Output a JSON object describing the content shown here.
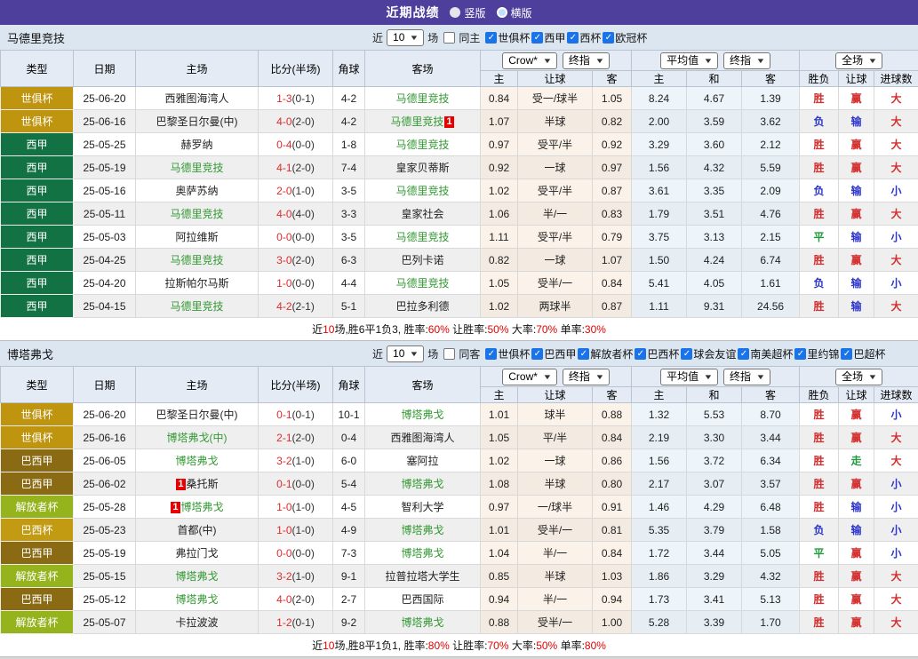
{
  "topbar": {
    "title": "近期战绩",
    "options": [
      {
        "label": "竖版",
        "checked": false
      },
      {
        "label": "横版",
        "checked": true
      }
    ]
  },
  "icons": {
    "check": "✓",
    "dropdown_arrow": "▼"
  },
  "colors": {
    "topbar_bg": "#4e3f9d",
    "checkbox_blue": "#1a73e8",
    "accent_red": "#e60000",
    "team_green": "#339933",
    "score_red": "#e12b2b",
    "leagues": {
      "世俱杯": "#bf940f",
      "西甲": "#127243",
      "巴西甲": "#8a6a12",
      "解放者杯": "#95b31d",
      "巴西杯": "#c39b13"
    },
    "result": {
      "r": "#d42f2f",
      "b": "#2d35c8",
      "g": "#22993e"
    }
  },
  "table_header": {
    "main_columns": [
      "类型",
      "日期",
      "主场",
      "比分(半场)",
      "角球",
      "客场"
    ],
    "sub_columns": [
      "主",
      "让球",
      "客",
      "主",
      "和",
      "客",
      "胜负",
      "让球",
      "进球数"
    ],
    "selects": {
      "book": "Crow*",
      "book_final": "终指",
      "avg": "平均值",
      "avg_final": "终指",
      "scope": "全场"
    }
  },
  "sections": [
    {
      "team": "马德里竞技",
      "filter": {
        "prefix": "近",
        "count": "10",
        "suffix": "场",
        "same_side_label": "同主",
        "same_side_checked": false,
        "leagues": [
          "世俱杯",
          "西甲",
          "西杯",
          "欧冠杯"
        ]
      },
      "rows": [
        {
          "lg": "世俱杯",
          "date": "25-06-20",
          "home": {
            "n": "西雅图海湾人"
          },
          "score": "1-3",
          "half": "(0-1)",
          "corner": "4-2",
          "away": {
            "n": "马德里竞技",
            "g": 1
          },
          "o": [
            "0.84",
            "受一/球半",
            "1.05"
          ],
          "a": [
            "8.24",
            "4.67",
            "1.39"
          ],
          "r": [
            [
              "胜",
              "r"
            ],
            [
              "赢",
              "r"
            ],
            [
              "大",
              "r"
            ]
          ]
        },
        {
          "lg": "世俱杯",
          "date": "25-06-16",
          "home": {
            "n": "巴黎圣日尔曼(中)"
          },
          "score": "4-0",
          "half": "(2-0)",
          "corner": "4-2",
          "away": {
            "n": "马德里竞技",
            "g": 1,
            "b": "1",
            "bp": "after"
          },
          "o": [
            "1.07",
            "半球",
            "0.82"
          ],
          "a": [
            "2.00",
            "3.59",
            "3.62"
          ],
          "r": [
            [
              "负",
              "b"
            ],
            [
              "输",
              "b"
            ],
            [
              "大",
              "r"
            ]
          ]
        },
        {
          "lg": "西甲",
          "date": "25-05-25",
          "home": {
            "n": "赫罗纳"
          },
          "score": "0-4",
          "half": "(0-0)",
          "corner": "1-8",
          "away": {
            "n": "马德里竞技",
            "g": 1
          },
          "o": [
            "0.97",
            "受平/半",
            "0.92"
          ],
          "a": [
            "3.29",
            "3.60",
            "2.12"
          ],
          "r": [
            [
              "胜",
              "r"
            ],
            [
              "赢",
              "r"
            ],
            [
              "大",
              "r"
            ]
          ]
        },
        {
          "lg": "西甲",
          "date": "25-05-19",
          "home": {
            "n": "马德里竞技",
            "g": 1
          },
          "score": "4-1",
          "half": "(2-0)",
          "corner": "7-4",
          "away": {
            "n": "皇家贝蒂斯"
          },
          "o": [
            "0.92",
            "一球",
            "0.97"
          ],
          "a": [
            "1.56",
            "4.32",
            "5.59"
          ],
          "r": [
            [
              "胜",
              "r"
            ],
            [
              "赢",
              "r"
            ],
            [
              "大",
              "r"
            ]
          ]
        },
        {
          "lg": "西甲",
          "date": "25-05-16",
          "home": {
            "n": "奥萨苏纳"
          },
          "score": "2-0",
          "half": "(1-0)",
          "corner": "3-5",
          "away": {
            "n": "马德里竞技",
            "g": 1
          },
          "o": [
            "1.02",
            "受平/半",
            "0.87"
          ],
          "a": [
            "3.61",
            "3.35",
            "2.09"
          ],
          "r": [
            [
              "负",
              "b"
            ],
            [
              "输",
              "b"
            ],
            [
              "小",
              "b"
            ]
          ]
        },
        {
          "lg": "西甲",
          "date": "25-05-11",
          "home": {
            "n": "马德里竞技",
            "g": 1
          },
          "score": "4-0",
          "half": "(4-0)",
          "corner": "3-3",
          "away": {
            "n": "皇家社会"
          },
          "o": [
            "1.06",
            "半/一",
            "0.83"
          ],
          "a": [
            "1.79",
            "3.51",
            "4.76"
          ],
          "r": [
            [
              "胜",
              "r"
            ],
            [
              "赢",
              "r"
            ],
            [
              "大",
              "r"
            ]
          ]
        },
        {
          "lg": "西甲",
          "date": "25-05-03",
          "home": {
            "n": "阿拉维斯"
          },
          "score": "0-0",
          "half": "(0-0)",
          "corner": "3-5",
          "away": {
            "n": "马德里竞技",
            "g": 1
          },
          "o": [
            "1.11",
            "受平/半",
            "0.79"
          ],
          "a": [
            "3.75",
            "3.13",
            "2.15"
          ],
          "r": [
            [
              "平",
              "g"
            ],
            [
              "输",
              "b"
            ],
            [
              "小",
              "b"
            ]
          ]
        },
        {
          "lg": "西甲",
          "date": "25-04-25",
          "home": {
            "n": "马德里竞技",
            "g": 1
          },
          "score": "3-0",
          "half": "(2-0)",
          "corner": "6-3",
          "away": {
            "n": "巴列卡诺"
          },
          "o": [
            "0.82",
            "一球",
            "1.07"
          ],
          "a": [
            "1.50",
            "4.24",
            "6.74"
          ],
          "r": [
            [
              "胜",
              "r"
            ],
            [
              "赢",
              "r"
            ],
            [
              "大",
              "r"
            ]
          ]
        },
        {
          "lg": "西甲",
          "date": "25-04-20",
          "home": {
            "n": "拉斯帕尔马斯"
          },
          "score": "1-0",
          "half": "(0-0)",
          "corner": "4-4",
          "away": {
            "n": "马德里竞技",
            "g": 1
          },
          "o": [
            "1.05",
            "受半/一",
            "0.84"
          ],
          "a": [
            "5.41",
            "4.05",
            "1.61"
          ],
          "r": [
            [
              "负",
              "b"
            ],
            [
              "输",
              "b"
            ],
            [
              "小",
              "b"
            ]
          ]
        },
        {
          "lg": "西甲",
          "date": "25-04-15",
          "home": {
            "n": "马德里竞技",
            "g": 1
          },
          "score": "4-2",
          "half": "(2-1)",
          "corner": "5-1",
          "away": {
            "n": "巴拉多利德"
          },
          "o": [
            "1.02",
            "两球半",
            "0.87"
          ],
          "a": [
            "1.11",
            "9.31",
            "24.56"
          ],
          "r": [
            [
              "胜",
              "r"
            ],
            [
              "输",
              "b"
            ],
            [
              "大",
              "r"
            ]
          ]
        }
      ],
      "summary": [
        {
          "t": "近"
        },
        {
          "t": "10",
          "red": true
        },
        {
          "t": "场,胜6平1负3, 胜率:"
        },
        {
          "t": "60%",
          "red": true
        },
        {
          "t": " 让胜率:"
        },
        {
          "t": "50%",
          "red": true
        },
        {
          "t": " 大率:"
        },
        {
          "t": "70%",
          "red": true
        },
        {
          "t": " 单率:"
        },
        {
          "t": "30%",
          "red": true
        }
      ]
    },
    {
      "team": "博塔弗戈",
      "filter": {
        "prefix": "近",
        "count": "10",
        "suffix": "场",
        "same_side_label": "同客",
        "same_side_checked": false,
        "leagues": [
          "世俱杯",
          "巴西甲",
          "解放者杯",
          "巴西杯",
          "球会友谊",
          "南美超杯",
          "里约锦",
          "巴超杯"
        ]
      },
      "rows": [
        {
          "lg": "世俱杯",
          "date": "25-06-20",
          "home": {
            "n": "巴黎圣日尔曼(中)"
          },
          "score": "0-1",
          "half": "(0-1)",
          "corner": "10-1",
          "away": {
            "n": "博塔弗戈",
            "g": 1
          },
          "o": [
            "1.01",
            "球半",
            "0.88"
          ],
          "a": [
            "1.32",
            "5.53",
            "8.70"
          ],
          "r": [
            [
              "胜",
              "r"
            ],
            [
              "赢",
              "r"
            ],
            [
              "小",
              "b"
            ]
          ]
        },
        {
          "lg": "世俱杯",
          "date": "25-06-16",
          "home": {
            "n": "博塔弗戈(中)",
            "g": 1
          },
          "score": "2-1",
          "half": "(2-0)",
          "corner": "0-4",
          "away": {
            "n": "西雅图海湾人"
          },
          "o": [
            "1.05",
            "平/半",
            "0.84"
          ],
          "a": [
            "2.19",
            "3.30",
            "3.44"
          ],
          "r": [
            [
              "胜",
              "r"
            ],
            [
              "赢",
              "r"
            ],
            [
              "大",
              "r"
            ]
          ]
        },
        {
          "lg": "巴西甲",
          "date": "25-06-05",
          "home": {
            "n": "博塔弗戈",
            "g": 1
          },
          "score": "3-2",
          "half": "(1-0)",
          "corner": "6-0",
          "away": {
            "n": "塞阿拉"
          },
          "o": [
            "1.02",
            "一球",
            "0.86"
          ],
          "a": [
            "1.56",
            "3.72",
            "6.34"
          ],
          "r": [
            [
              "胜",
              "r"
            ],
            [
              "走",
              "g"
            ],
            [
              "大",
              "r"
            ]
          ]
        },
        {
          "lg": "巴西甲",
          "date": "25-06-02",
          "home": {
            "n": "桑托斯",
            "b": "1",
            "bp": "before"
          },
          "score": "0-1",
          "half": "(0-0)",
          "corner": "5-4",
          "away": {
            "n": "博塔弗戈",
            "g": 1
          },
          "o": [
            "1.08",
            "半球",
            "0.80"
          ],
          "a": [
            "2.17",
            "3.07",
            "3.57"
          ],
          "r": [
            [
              "胜",
              "r"
            ],
            [
              "赢",
              "r"
            ],
            [
              "小",
              "b"
            ]
          ]
        },
        {
          "lg": "解放者杯",
          "date": "25-05-28",
          "home": {
            "n": "博塔弗戈",
            "g": 1,
            "b": "1",
            "bp": "before"
          },
          "score": "1-0",
          "half": "(1-0)",
          "corner": "4-5",
          "away": {
            "n": "智利大学"
          },
          "o": [
            "0.97",
            "一/球半",
            "0.91"
          ],
          "a": [
            "1.46",
            "4.29",
            "6.48"
          ],
          "r": [
            [
              "胜",
              "r"
            ],
            [
              "输",
              "b"
            ],
            [
              "小",
              "b"
            ]
          ]
        },
        {
          "lg": "巴西杯",
          "date": "25-05-23",
          "home": {
            "n": "首都(中)"
          },
          "score": "1-0",
          "half": "(1-0)",
          "corner": "4-9",
          "away": {
            "n": "博塔弗戈",
            "g": 1
          },
          "o": [
            "1.01",
            "受半/一",
            "0.81"
          ],
          "a": [
            "5.35",
            "3.79",
            "1.58"
          ],
          "r": [
            [
              "负",
              "b"
            ],
            [
              "输",
              "b"
            ],
            [
              "小",
              "b"
            ]
          ]
        },
        {
          "lg": "巴西甲",
          "date": "25-05-19",
          "home": {
            "n": "弗拉门戈"
          },
          "score": "0-0",
          "half": "(0-0)",
          "corner": "7-3",
          "away": {
            "n": "博塔弗戈",
            "g": 1
          },
          "o": [
            "1.04",
            "半/一",
            "0.84"
          ],
          "a": [
            "1.72",
            "3.44",
            "5.05"
          ],
          "r": [
            [
              "平",
              "g"
            ],
            [
              "赢",
              "r"
            ],
            [
              "小",
              "b"
            ]
          ]
        },
        {
          "lg": "解放者杯",
          "date": "25-05-15",
          "home": {
            "n": "博塔弗戈",
            "g": 1
          },
          "score": "3-2",
          "half": "(1-0)",
          "corner": "9-1",
          "away": {
            "n": "拉普拉塔大学生"
          },
          "o": [
            "0.85",
            "半球",
            "1.03"
          ],
          "a": [
            "1.86",
            "3.29",
            "4.32"
          ],
          "r": [
            [
              "胜",
              "r"
            ],
            [
              "赢",
              "r"
            ],
            [
              "大",
              "r"
            ]
          ]
        },
        {
          "lg": "巴西甲",
          "date": "25-05-12",
          "home": {
            "n": "博塔弗戈",
            "g": 1
          },
          "score": "4-0",
          "half": "(2-0)",
          "corner": "2-7",
          "away": {
            "n": "巴西国际"
          },
          "o": [
            "0.94",
            "半/一",
            "0.94"
          ],
          "a": [
            "1.73",
            "3.41",
            "5.13"
          ],
          "r": [
            [
              "胜",
              "r"
            ],
            [
              "赢",
              "r"
            ],
            [
              "大",
              "r"
            ]
          ]
        },
        {
          "lg": "解放者杯",
          "date": "25-05-07",
          "home": {
            "n": "卡拉波波"
          },
          "score": "1-2",
          "half": "(0-1)",
          "corner": "9-2",
          "away": {
            "n": "博塔弗戈",
            "g": 1
          },
          "o": [
            "0.88",
            "受半/一",
            "1.00"
          ],
          "a": [
            "5.28",
            "3.39",
            "1.70"
          ],
          "r": [
            [
              "胜",
              "r"
            ],
            [
              "赢",
              "r"
            ],
            [
              "大",
              "r"
            ]
          ]
        }
      ],
      "summary": [
        {
          "t": "近"
        },
        {
          "t": "10",
          "red": true
        },
        {
          "t": "场,胜8平1负1, 胜率:"
        },
        {
          "t": "80%",
          "red": true
        },
        {
          "t": " 让胜率:"
        },
        {
          "t": "70%",
          "red": true
        },
        {
          "t": " 大率:"
        },
        {
          "t": "50%",
          "red": true
        },
        {
          "t": " 单率:"
        },
        {
          "t": "80%",
          "red": true
        }
      ]
    }
  ]
}
